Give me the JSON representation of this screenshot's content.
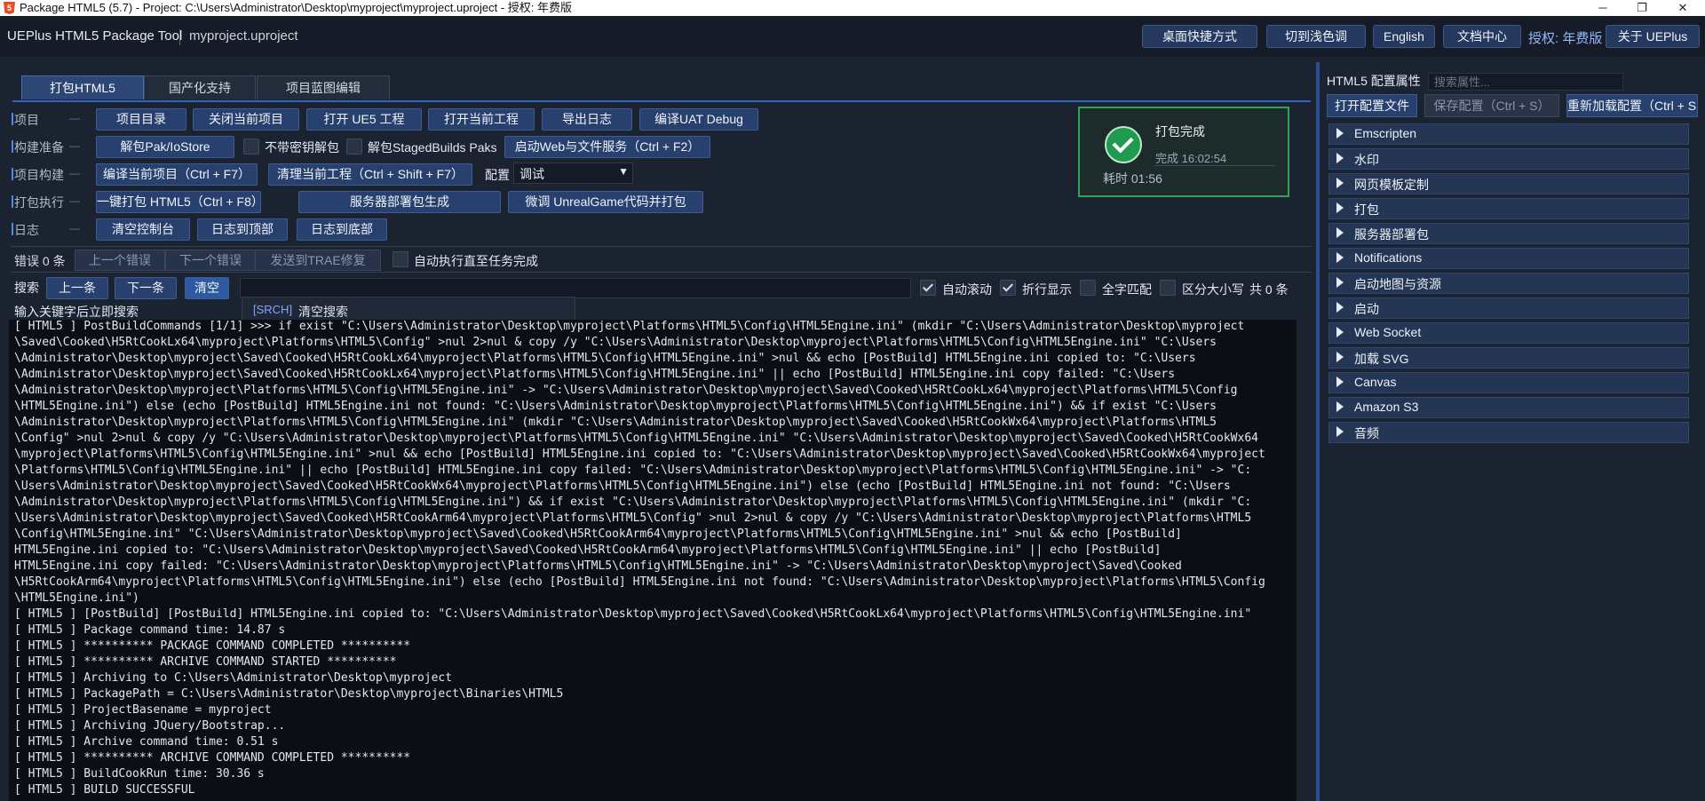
{
  "window": {
    "title": "Package HTML5 (5.7) - Project: C:\\Users\\Administrator\\Desktop\\myproject\\myproject.uproject - 授权: 年费版",
    "logo_text": "5",
    "controls": {
      "minimize": "─",
      "maximize": "❐",
      "close": "✕"
    }
  },
  "header": {
    "app_name": "UEPlus HTML5 Package Tool",
    "project": "myproject.uproject",
    "buttons": [
      "桌面快捷方式",
      "切到浅色调",
      "English",
      "文档中心"
    ],
    "license": "授权: 年费版",
    "about": "关于 UEPlus"
  },
  "tabs": [
    "打包HTML5",
    "国产化支持",
    "项目蓝图编辑"
  ],
  "rows": {
    "project": {
      "label": "项目",
      "dash": "—",
      "buttons": [
        "项目目录",
        "关闭当前项目",
        "打开 UE5 工程",
        "打开当前工程",
        "导出日志",
        "编译UAT Debug"
      ]
    },
    "build_prep": {
      "label": "构建准备",
      "dash": "—",
      "unpack_button": "解包Pak/IoStore",
      "no_key_label": "不带密钥解包",
      "staged_label": "解包StagedBuilds Paks",
      "web_button": "启动Web与文件服务（Ctrl + F2）"
    },
    "build": {
      "label": "项目构建",
      "dash": "—",
      "compile_button": "编译当前项目（Ctrl + F7）",
      "clean_button": "清理当前工程（Ctrl + Shift + F7）",
      "config_label": "配置",
      "config_value": "调试",
      "config_arrow": "▼"
    },
    "package": {
      "label": "打包执行",
      "dash": "—",
      "buttons": [
        "一键打包 HTML5（Ctrl + F8）",
        "服务器部署包生成",
        "微调 UnrealGame代码并打包"
      ]
    },
    "log": {
      "label": "日志",
      "dash": "—",
      "buttons": [
        "清空控制台",
        "日志到顶部",
        "日志到底部"
      ]
    }
  },
  "status_card": {
    "title": "打包完成",
    "time": "完成 16:02:54",
    "elapsed": "耗时 01:56"
  },
  "errors": {
    "count_label": "错误 0 条",
    "prev": "上一个错误",
    "next": "下一个错误",
    "send": "发送到TRAE修复",
    "auto_label": "自动执行直至任务完成"
  },
  "search": {
    "label": "搜索",
    "prev": "上一条",
    "next": "下一条",
    "clear": "清空",
    "input_value": "",
    "auto_scroll": "自动滚动",
    "wrap": "折行显示",
    "whole_word": "全字匹配",
    "case": "区分大小写",
    "count": "共 0 条",
    "hint": "输入关键字后立即搜索",
    "dropdown_tag": "[SRCH]",
    "dropdown_item": "清空搜索"
  },
  "console_lines": [
    "[ HTML5 ] PostBuildCommands [1/1] >>> if exist \"C:\\Users\\Administrator\\Desktop\\myproject\\Platforms\\HTML5\\Config\\HTML5Engine.ini\" (mkdir \"C:\\Users\\Administrator\\Desktop\\myproject",
    "\\Saved\\Cooked\\H5RtCookLx64\\myproject\\Platforms\\HTML5\\Config\" >nul 2>nul & copy /y \"C:\\Users\\Administrator\\Desktop\\myproject\\Platforms\\HTML5\\Config\\HTML5Engine.ini\" \"C:\\Users",
    "\\Administrator\\Desktop\\myproject\\Saved\\Cooked\\H5RtCookLx64\\myproject\\Platforms\\HTML5\\Config\\HTML5Engine.ini\" >nul && echo [PostBuild] HTML5Engine.ini copied to: \"C:\\Users",
    "\\Administrator\\Desktop\\myproject\\Saved\\Cooked\\H5RtCookLx64\\myproject\\Platforms\\HTML5\\Config\\HTML5Engine.ini\" || echo [PostBuild] HTML5Engine.ini copy failed: \"C:\\Users",
    "\\Administrator\\Desktop\\myproject\\Platforms\\HTML5\\Config\\HTML5Engine.ini\" -> \"C:\\Users\\Administrator\\Desktop\\myproject\\Saved\\Cooked\\H5RtCookLx64\\myproject\\Platforms\\HTML5\\Config",
    "\\HTML5Engine.ini\") else (echo [PostBuild] HTML5Engine.ini not found: \"C:\\Users\\Administrator\\Desktop\\myproject\\Platforms\\HTML5\\Config\\HTML5Engine.ini\") && if exist \"C:\\Users",
    "\\Administrator\\Desktop\\myproject\\Platforms\\HTML5\\Config\\HTML5Engine.ini\" (mkdir \"C:\\Users\\Administrator\\Desktop\\myproject\\Saved\\Cooked\\H5RtCookWx64\\myproject\\Platforms\\HTML5",
    "\\Config\" >nul 2>nul & copy /y \"C:\\Users\\Administrator\\Desktop\\myproject\\Platforms\\HTML5\\Config\\HTML5Engine.ini\" \"C:\\Users\\Administrator\\Desktop\\myproject\\Saved\\Cooked\\H5RtCookWx64",
    "\\myproject\\Platforms\\HTML5\\Config\\HTML5Engine.ini\" >nul && echo [PostBuild] HTML5Engine.ini copied to: \"C:\\Users\\Administrator\\Desktop\\myproject\\Saved\\Cooked\\H5RtCookWx64\\myproject",
    "\\Platforms\\HTML5\\Config\\HTML5Engine.ini\" || echo [PostBuild] HTML5Engine.ini copy failed: \"C:\\Users\\Administrator\\Desktop\\myproject\\Platforms\\HTML5\\Config\\HTML5Engine.ini\" -> \"C:",
    "\\Users\\Administrator\\Desktop\\myproject\\Saved\\Cooked\\H5RtCookWx64\\myproject\\Platforms\\HTML5\\Config\\HTML5Engine.ini\") else (echo [PostBuild] HTML5Engine.ini not found: \"C:\\Users",
    "\\Administrator\\Desktop\\myproject\\Platforms\\HTML5\\Config\\HTML5Engine.ini\") && if exist \"C:\\Users\\Administrator\\Desktop\\myproject\\Platforms\\HTML5\\Config\\HTML5Engine.ini\" (mkdir \"C:",
    "\\Users\\Administrator\\Desktop\\myproject\\Saved\\Cooked\\H5RtCookArm64\\myproject\\Platforms\\HTML5\\Config\" >nul 2>nul & copy /y \"C:\\Users\\Administrator\\Desktop\\myproject\\Platforms\\HTML5",
    "\\Config\\HTML5Engine.ini\" \"C:\\Users\\Administrator\\Desktop\\myproject\\Saved\\Cooked\\H5RtCookArm64\\myproject\\Platforms\\HTML5\\Config\\HTML5Engine.ini\" >nul && echo [PostBuild]",
    "HTML5Engine.ini copied to: \"C:\\Users\\Administrator\\Desktop\\myproject\\Saved\\Cooked\\H5RtCookArm64\\myproject\\Platforms\\HTML5\\Config\\HTML5Engine.ini\" || echo [PostBuild]",
    "HTML5Engine.ini copy failed: \"C:\\Users\\Administrator\\Desktop\\myproject\\Platforms\\HTML5\\Config\\HTML5Engine.ini\" -> \"C:\\Users\\Administrator\\Desktop\\myproject\\Saved\\Cooked",
    "\\H5RtCookArm64\\myproject\\Platforms\\HTML5\\Config\\HTML5Engine.ini\") else (echo [PostBuild] HTML5Engine.ini not found: \"C:\\Users\\Administrator\\Desktop\\myproject\\Platforms\\HTML5\\Config",
    "\\HTML5Engine.ini\")",
    "[ HTML5 ] [PostBuild] [PostBuild] HTML5Engine.ini copied to: \"C:\\Users\\Administrator\\Desktop\\myproject\\Saved\\Cooked\\H5RtCookLx64\\myproject\\Platforms\\HTML5\\Config\\HTML5Engine.ini\"",
    "[ HTML5 ] Package command time: 14.87 s",
    "[ HTML5 ] ********** PACKAGE COMMAND COMPLETED **********",
    "[ HTML5 ] ********** ARCHIVE COMMAND STARTED **********",
    "[ HTML5 ] Archiving to C:\\Users\\Administrator\\Desktop\\myproject",
    "[ HTML5 ] PackagePath = C:\\Users\\Administrator\\Desktop\\myproject\\Binaries\\HTML5",
    "[ HTML5 ] ProjectBasename = myproject",
    "[ HTML5 ] Archiving JQuery/Bootstrap...",
    "[ HTML5 ] Archive command time: 0.51 s",
    "[ HTML5 ] ********** ARCHIVE COMMAND COMPLETED **********",
    "[ HTML5 ] BuildCookRun time: 30.36 s",
    "[ HTML5 ] BUILD SUCCESSFUL"
  ],
  "right_panel": {
    "title": "HTML5 配置属性",
    "search_placeholder": "搜索属性...",
    "open_config": "打开配置文件",
    "save_config": "保存配置（Ctrl + S）",
    "reload_config": "重新加载配置（Ctrl + Shift + R）",
    "sections": [
      "Emscripten",
      "水印",
      "网页模板定制",
      "打包",
      "服务器部署包",
      "Notifications",
      "启动地图与资源",
      "启动",
      "Web Socket",
      "加载 SVG",
      "Canvas",
      "Amazon S3",
      "音频"
    ]
  },
  "colors": {
    "accent": "#2f63c2",
    "button": "#27406d",
    "success": "#1f9a4f",
    "console_bg": "#0b0e13"
  }
}
